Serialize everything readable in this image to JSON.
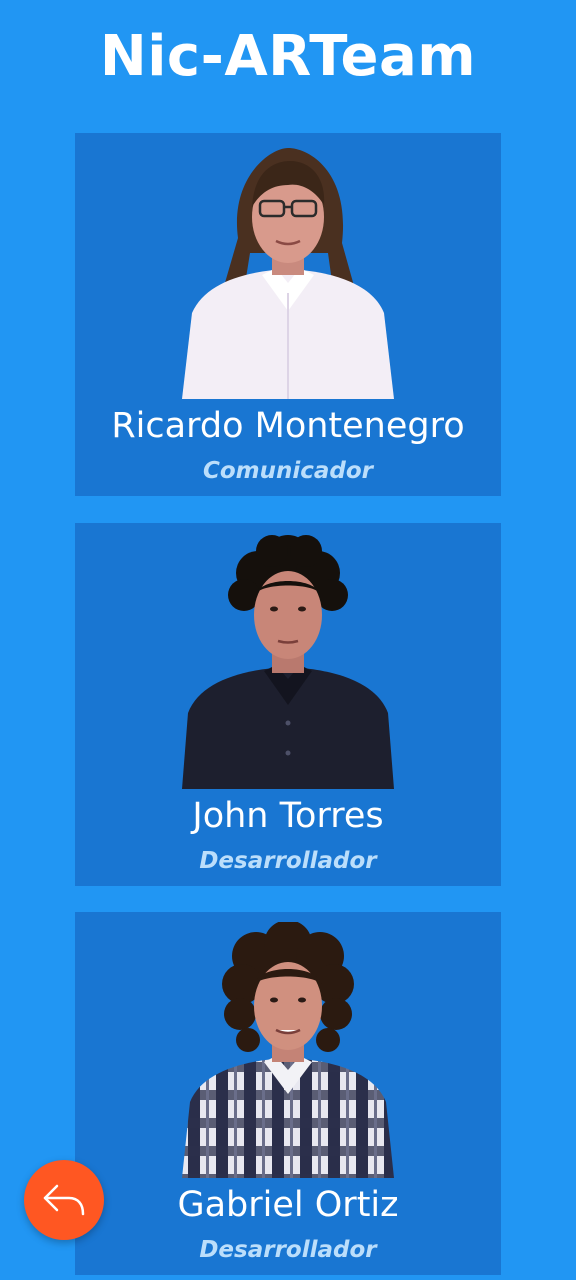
{
  "header": {
    "title": "Nic-ARTeam"
  },
  "team": [
    {
      "name": "Ricardo Montenegro",
      "role": "Comunicador",
      "photo_icon": "person-photo-glasses-white-shirt"
    },
    {
      "name": "John Torres",
      "role": "Desarrollador",
      "photo_icon": "person-photo-curly-hair-dark-shirt"
    },
    {
      "name": "Gabriel Ortiz",
      "role": "Desarrollador",
      "photo_icon": "person-photo-curly-hair-plaid-shirt"
    }
  ],
  "back_button": {
    "icon": "reply-arrow-icon",
    "color": "#FF5722"
  },
  "colors": {
    "background": "#2196F3",
    "card": "#1976D2",
    "role_text": "#BBDEFB",
    "accent": "#FF5722"
  }
}
